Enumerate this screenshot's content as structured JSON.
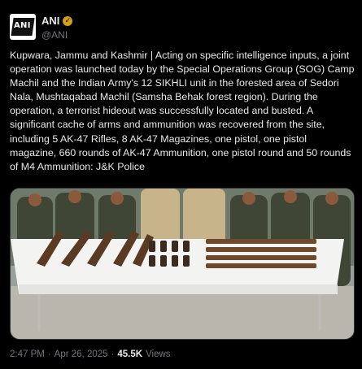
{
  "tweet": {
    "author": {
      "display_name": "ANI",
      "handle": "@ANI",
      "avatar_text": "ANI",
      "verified_badge": "gold-check-icon"
    },
    "text": "Kupwara, Jammu and Kashmir | Acting on specific intelligence inputs, a joint operation was launched today by the Special Operations Group (SOG) Camp Machil and the Indian Army's 12 SIKHLI unit in the forested area of Sedori Nala, Mushtaqabad Machil (Samsha Behak forest region). During the operation, a terrorist hideout was successfully located and busted. A significant cache of arms and ammunition was recovered from the site, including 5 AK-47 Rifles, 8 AK-47 Magazines, one pistol, one pistol magazine, 660 rounds of AK-47 Ammunition, one pistol round and 50 rounds of M4 Ammunition: J&K Police",
    "media_description_icon": "photo-icon",
    "time": "2:47 PM",
    "separator": "·",
    "date": "Apr 26, 2025",
    "views_count": "45.5K",
    "views_label": "Views"
  },
  "colors": {
    "background": "#000000",
    "text_primary": "#e7e9ea",
    "text_secondary": "#71767b",
    "verified_gold": "#d4a017"
  }
}
